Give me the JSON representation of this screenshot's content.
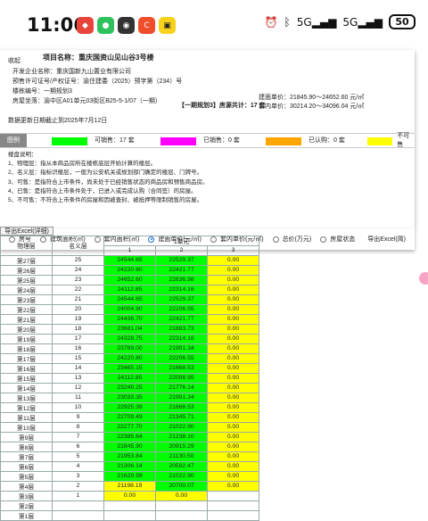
{
  "status_bar": {
    "time": "11:06",
    "battery": "50",
    "network_1": "5G",
    "network_2": "5G"
  },
  "header": {
    "project_label": "收起",
    "project_title_label": "项目名称：",
    "project_name": "重庆国资山见山谷3号楼",
    "developer": "开发企业名称：重庆国新九山置业有限公司",
    "license": "预售许可证号/产权证号：渝住建委（2025）预字第（234）号",
    "building_no": "楼栋编号：一期规划3",
    "location": "房屋坐落：渝中区A01单元03街区B25-5-1/07（一期）",
    "tag": "【一期规划3】房源共计：17 套",
    "unit_price_label": "建面单价：",
    "unit_price": "21845.90～24652.60 元/㎡",
    "inner_price_label": "套内单价：",
    "inner_price": "30214.20～34096.04 元/㎡",
    "update": "数据更新日期截止到2025年7月12日"
  },
  "legend": {
    "title": "图例",
    "items": [
      {
        "label": "可销售：17 套",
        "color": "#00ff00"
      },
      {
        "label": "已销售：0 套",
        "color": "#ff00ff"
      },
      {
        "label": "已认购：0 套",
        "color": "#ffa500"
      },
      {
        "label": "不可售",
        "color": "#ffff00"
      }
    ]
  },
  "notes": {
    "title": "楼盘说明：",
    "lines": [
      "1、物理层：指从本商品房所在楼栋底层开始计算的楼层。",
      "2、名义层：指标识楼层，一般为公安机关或规划部门确定的楼层、门牌号。",
      "3、可售：是指符合上市条件，尚未处于已经销售状态的商品房和预售商品房。",
      "4、已售：是指符合上市条件处于，已进入或完成认购（合同签）的房屋。",
      "5、不可售：不符合上市条件的房屋和因被查封、被抵押等限制销售的房屋。"
    ]
  },
  "options": {
    "items": [
      "房号",
      "建筑面积(㎡)",
      "套内面积(㎡)",
      "建面单价(元/㎡)",
      "套内单价(元/㎡)",
      "总价(万元)",
      "房屋状态",
      "导出Excel(简)"
    ],
    "selected": "建面单价(元/㎡)"
  },
  "table": {
    "export_label": "导出Excel(详细)",
    "unit_header": "1单元",
    "col_physical": "物理层",
    "col_nominal": "名义层",
    "room_cols": [
      "1",
      "2",
      "3"
    ],
    "rows": [
      {
        "phys": "第27层",
        "nom": "25",
        "v": [
          "24544.65",
          "22529.37",
          "0.00"
        ]
      },
      {
        "phys": "第26层",
        "nom": "24",
        "v": [
          "24220.80",
          "22421.77",
          "0.00"
        ]
      },
      {
        "phys": "第25层",
        "nom": "23",
        "v": [
          "24652.60",
          "22636.98",
          "0.00"
        ]
      },
      {
        "phys": "第24层",
        "nom": "22",
        "v": [
          "24112.85",
          "22314.16",
          "0.00"
        ]
      },
      {
        "phys": "第23层",
        "nom": "21",
        "v": [
          "24544.65",
          "22529.37",
          "0.00"
        ]
      },
      {
        "phys": "第22层",
        "nom": "20",
        "v": [
          "24004.90",
          "22206.55",
          "0.00"
        ]
      },
      {
        "phys": "第21层",
        "nom": "19",
        "v": [
          "24436.70",
          "22421.77",
          "0.00"
        ]
      },
      {
        "phys": "第20层",
        "nom": "18",
        "v": [
          "23681.04",
          "21883.73",
          "0.00"
        ]
      },
      {
        "phys": "第19层",
        "nom": "17",
        "v": [
          "24328.75",
          "22314.16",
          "0.00"
        ]
      },
      {
        "phys": "第18层",
        "nom": "16",
        "v": [
          "23789.00",
          "21991.34",
          "0.00"
        ]
      },
      {
        "phys": "第17层",
        "nom": "15",
        "v": [
          "24220.80",
          "22206.55",
          "0.00"
        ]
      },
      {
        "phys": "第16层",
        "nom": "14",
        "v": [
          "23465.15",
          "21668.53",
          "0.00"
        ]
      },
      {
        "phys": "第15层",
        "nom": "13",
        "v": [
          "24112.85",
          "22098.95",
          "0.00"
        ]
      },
      {
        "phys": "第14层",
        "nom": "12",
        "v": [
          "23249.25",
          "21776.14",
          "0.00"
        ]
      },
      {
        "phys": "第13层",
        "nom": "11",
        "v": [
          "23033.35",
          "21991.34",
          "0.00"
        ]
      },
      {
        "phys": "第12层",
        "nom": "10",
        "v": [
          "22925.39",
          "21668.53",
          "0.00"
        ]
      },
      {
        "phys": "第11层",
        "nom": "9",
        "v": [
          "22709.49",
          "21345.71",
          "0.00"
        ]
      },
      {
        "phys": "第10层",
        "nom": "8",
        "v": [
          "22277.70",
          "21022.90",
          "0.00"
        ]
      },
      {
        "phys": "第9层",
        "nom": "7",
        "v": [
          "22385.64",
          "21238.10",
          "0.00"
        ]
      },
      {
        "phys": "第8层",
        "nom": "6",
        "v": [
          "21845.90",
          "20915.29",
          "0.00"
        ]
      },
      {
        "phys": "第7层",
        "nom": "5",
        "v": [
          "21953.84",
          "21130.50",
          "0.00"
        ]
      },
      {
        "phys": "第6层",
        "nom": "4",
        "v": [
          "21306.14",
          "20592.47",
          "0.00"
        ]
      },
      {
        "phys": "第5层",
        "nom": "3",
        "v": [
          "21629.99",
          "21022.90",
          "0.00"
        ]
      },
      {
        "phys": "第4层",
        "nom": "2",
        "v": [
          "21198.19",
          "20700.07",
          "0.00"
        ]
      },
      {
        "phys": "第3层",
        "nom": "1",
        "v": [
          "0.00",
          "0.00",
          ""
        ]
      },
      {
        "phys": "第2层",
        "nom": "",
        "v": [
          "",
          "",
          ""
        ]
      },
      {
        "phys": "第1层",
        "nom": "",
        "v": [
          "",
          "",
          ""
        ]
      }
    ]
  },
  "colors": {
    "available": "#00ff00",
    "unavailable": "#ffff00"
  }
}
